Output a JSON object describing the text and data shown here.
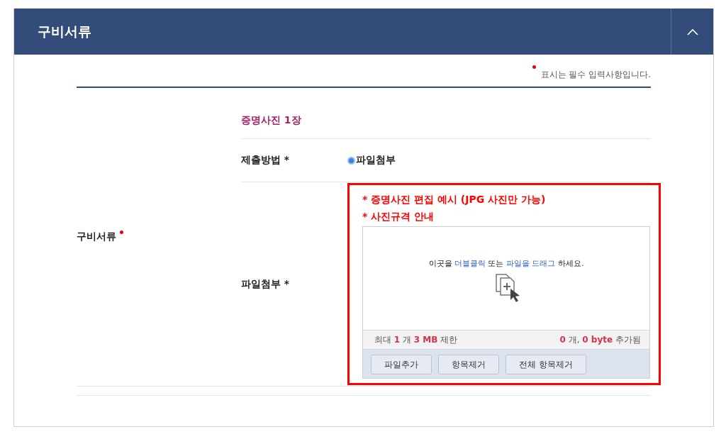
{
  "section": {
    "title": "구비서류",
    "expanded": true
  },
  "required_note": "표시는 필수 입력사항입니다.",
  "form": {
    "label": "구비서류",
    "required": true,
    "document": "증명사진 1장",
    "rows": [
      {
        "kind": "radio",
        "label": "제출방법 *",
        "options": [
          {
            "label": "파일첨부",
            "selected": true
          }
        ]
      },
      {
        "kind": "upload",
        "label": "파일첨부 *",
        "highlighted": true,
        "notes": [
          "* 증명사진 편집 예시 (JPG 사진만 가능)",
          "* 사진규격 안내"
        ],
        "uploader": {
          "hint": [
            {
              "text": "이곳을 ",
              "emphasis": false
            },
            {
              "text": "더블클릭",
              "emphasis": true
            },
            {
              "text": " 또는 ",
              "emphasis": false
            },
            {
              "text": "파일을 드래그",
              "emphasis": true
            },
            {
              "text": " 하세요.",
              "emphasis": false
            }
          ],
          "limit": "최대 **1** 개 **3 MB** 제한",
          "added": "**0** 개, **0 byte** 추가됨",
          "buttons": [
            "파일추가",
            "항목제거",
            "전체 항목제거"
          ]
        }
      }
    ]
  }
}
